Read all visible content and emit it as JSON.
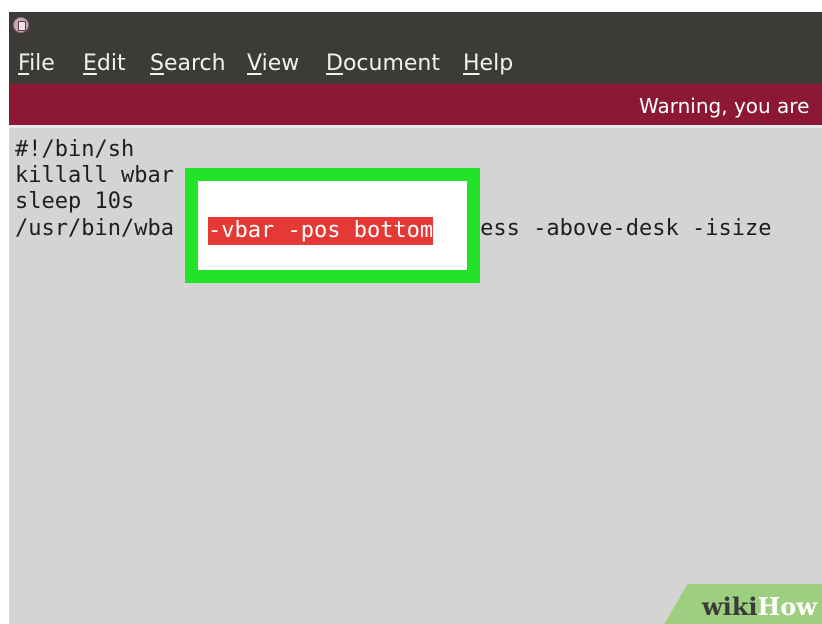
{
  "window": {
    "title_icon": "app-icon"
  },
  "menubar": {
    "items": [
      {
        "mnemonic": "F",
        "rest": "ile"
      },
      {
        "mnemonic": "E",
        "rest": "dit"
      },
      {
        "mnemonic": "S",
        "rest": "earch"
      },
      {
        "mnemonic": "V",
        "rest": "iew"
      },
      {
        "mnemonic": "D",
        "rest": "ocument"
      },
      {
        "mnemonic": "H",
        "rest": "elp"
      }
    ]
  },
  "warning": {
    "text": "Warning, you are"
  },
  "editor": {
    "lines": [
      "#!/bin/sh",
      "killall wbar",
      "sleep 10s"
    ],
    "line4": {
      "before": "/usr/bin/wba",
      "selected": "-vbar -pos bottom",
      "after": " bpress -above-desk -isize"
    }
  },
  "colors": {
    "menubar": "#3c3b37",
    "warning_bar": "#8c1835",
    "editor_bg": "#d4d4d4",
    "highlight_frame": "#22e32a",
    "selection": "#e53935"
  },
  "watermark": {
    "part1": "wiki",
    "part2": "How"
  }
}
